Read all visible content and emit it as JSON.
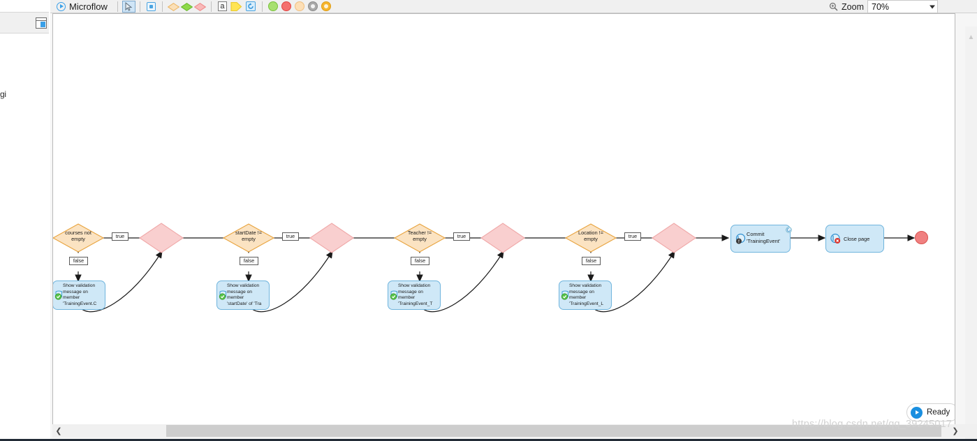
{
  "window": {
    "tab_title": "Microflow",
    "tab_icon": "microflow-play-icon"
  },
  "toolbar": {
    "tools": [
      {
        "name": "pointer-tool",
        "icon": "cursor-arrow-icon",
        "selected": true
      },
      {
        "name": "object-tool",
        "icon": "square-object-icon",
        "selected": false
      },
      {
        "name": "decision-tool",
        "icon": "orange-diamond-icon",
        "selected": false,
        "color": "#f7d9a8"
      },
      {
        "name": "merge-tool",
        "icon": "green-diamond-icon",
        "selected": false,
        "color": "#8fd44a"
      },
      {
        "name": "validation-tool",
        "icon": "pink-diamond-icon",
        "selected": false,
        "color": "#f4a6a6"
      },
      {
        "name": "annotation-tool",
        "icon": "letter-a-icon",
        "selected": false
      },
      {
        "name": "arrow-tool",
        "icon": "yellow-arrow-icon",
        "selected": false,
        "color": "#ffe14d"
      },
      {
        "name": "loop-tool",
        "icon": "loop-refresh-icon",
        "selected": false
      },
      {
        "name": "start-event-tool",
        "icon": "green-circle-icon",
        "selected": false,
        "color": "#a5e06a"
      },
      {
        "name": "error-event-tool",
        "icon": "red-circle-icon",
        "selected": false,
        "color": "#f2706e"
      },
      {
        "name": "continue-event-tool",
        "icon": "peach-circle-icon",
        "selected": false,
        "color": "#fcd9b0"
      },
      {
        "name": "break-event-tool",
        "icon": "grey-ring-icon",
        "selected": false,
        "color": "#b6b6b6"
      },
      {
        "name": "end-event-tool",
        "icon": "orange-ring-icon",
        "selected": false,
        "color": "#f7b733"
      }
    ]
  },
  "zoom": {
    "icon": "magnifier-icon",
    "label": "Zoom",
    "value": "70%",
    "caret": "chevron-down-icon"
  },
  "left_panel": {
    "panel_icon": "panel-layout-icon",
    "fragment_text": "gi"
  },
  "diagram": {
    "branches": [
      {
        "decision_text": "courses not\nempty",
        "true_label": "true",
        "false_label": "false",
        "activity_text": "Show validation\nmessage on\nmember\n'TrainingEvent.C",
        "activity_icon": "validation-message-icon"
      },
      {
        "decision_text": "startDate !=\nempty",
        "true_label": "true",
        "false_label": "false",
        "activity_text": "Show validation\nmessage on\nmember\n'startDate' of 'Tra",
        "activity_icon": "validation-message-icon"
      },
      {
        "decision_text": "Teacher !=\nempty",
        "true_label": "true",
        "false_label": "false",
        "activity_text": "Show validation\nmessage on\nmember\n'TrainingEvent_T",
        "activity_icon": "validation-message-icon"
      },
      {
        "decision_text": "Location !=\nempty",
        "true_label": "true",
        "false_label": "false",
        "activity_text": "Show validation\nmessage on\nmember\n'TrainingEvent_L",
        "activity_icon": "validation-message-icon"
      }
    ],
    "commit_activity": {
      "text": "Commit\n'TrainingEvent'",
      "icon": "commit-object-icon",
      "badge_icons": [
        "commit-up-arrow-icon",
        "refresh-icon"
      ]
    },
    "close_page_activity": {
      "text": "Close page",
      "icon": "close-page-icon"
    },
    "end_event": {
      "icon": "end-event-red-circle"
    }
  },
  "status": {
    "ready_label": "Ready",
    "ready_icon": "run-ready-icon"
  },
  "scrollbars": {
    "h_left_arrow": "❮",
    "h_right_arrow": "❯",
    "v_up_arrow": "▲",
    "v_down_arrow": "▼"
  },
  "watermark": {
    "text": "https://blog.csdn.net/qq_39245017"
  },
  "colors": {
    "decision_fill": "#fbe3c2",
    "decision_stroke": "#e8a33d",
    "merge_fill": "#f9cfcf",
    "merge_stroke": "#e98b8b",
    "activity_fill": "#cfe8f7",
    "activity_stroke": "#6fb4dd",
    "accent_blue": "#1a8fe0",
    "end_red": "#f08080"
  }
}
